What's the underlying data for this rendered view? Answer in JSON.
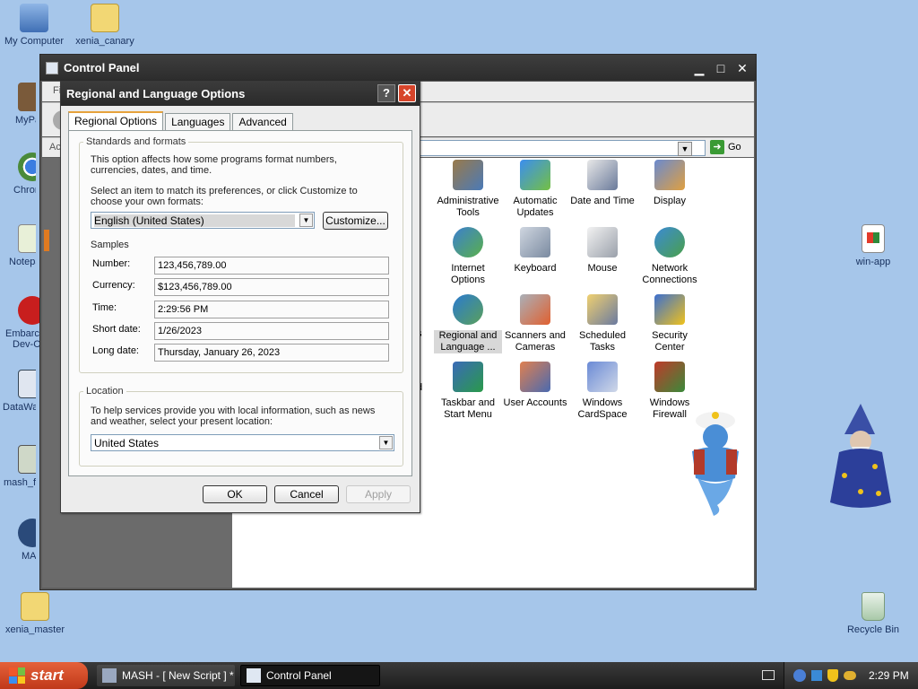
{
  "desktop_icons": {
    "my_computer": "My Computer",
    "xenia_canary": "xenia_canary",
    "mypa": "MyPa",
    "chrome": "Chron",
    "notepad": "Notepa",
    "embarcadero_1": "Embarca",
    "embarcadero_2": "Dev-C",
    "datawa": "DataWa",
    "mash_fu": "mash_fu",
    "mas": "MAS",
    "xenia_master": "xenia_master",
    "win_app": "win-app",
    "recycle_bin": "Recycle Bin"
  },
  "control_panel": {
    "title": "Control Panel",
    "menu_fragment": "Fi",
    "address_fragment": "Ac",
    "go_label": "Go",
    "left_fragment_1": "s",
    "left_fragment_2": "d",
    "items": [
      {
        "label1": "Administrative",
        "label2": "Tools",
        "icon": "admin-tools-icon"
      },
      {
        "label1": "Automatic",
        "label2": "Updates",
        "icon": "automatic-updates-icon"
      },
      {
        "label1": "Date and Time",
        "label2": "",
        "icon": "date-time-icon"
      },
      {
        "label1": "Display",
        "label2": "",
        "icon": "display-icon"
      },
      {
        "label1": "Internet",
        "label2": "Options",
        "icon": "internet-options-icon"
      },
      {
        "label1": "Keyboard",
        "label2": "",
        "icon": "keyboard-icon"
      },
      {
        "label1": "Mouse",
        "label2": "",
        "icon": "mouse-icon"
      },
      {
        "label1": "Network",
        "label2": "Connections",
        "icon": "network-icon"
      },
      {
        "label1": "Regional and",
        "label2": "Language ...",
        "icon": "regional-globe-icon"
      },
      {
        "label1": "Scanners and",
        "label2": "Cameras",
        "icon": "scanner-icon"
      },
      {
        "label1": "Scheduled",
        "label2": "Tasks",
        "icon": "scheduled-tasks-icon"
      },
      {
        "label1": "Security",
        "label2": "Center",
        "icon": "security-shield-icon"
      },
      {
        "label1": "Taskbar and",
        "label2": "Start Menu",
        "icon": "taskbar-icon"
      },
      {
        "label1": "User Accounts",
        "label2": "",
        "icon": "user-accounts-icon"
      },
      {
        "label1": "Windows",
        "label2": "CardSpace",
        "icon": "cardspace-icon"
      },
      {
        "label1": "Windows",
        "label2": "Firewall",
        "icon": "firewall-icon"
      }
    ]
  },
  "dialog": {
    "title": "Regional and Language Options",
    "help": "?",
    "close": "✕",
    "tabs": [
      "Regional Options",
      "Languages",
      "Advanced"
    ],
    "standards": {
      "legend": "Standards and formats",
      "para1": "This option affects how some programs format numbers, currencies, dates, and time.",
      "para2": "Select an item to match its preferences, or click Customize to choose your own formats:",
      "format_value": "English (United States)",
      "customize": "Customize..."
    },
    "samples": {
      "title": "Samples",
      "rows": [
        {
          "label": "Number:",
          "value": "123,456,789.00"
        },
        {
          "label": "Currency:",
          "value": "$123,456,789.00"
        },
        {
          "label": "Time:",
          "value": "2:29:56 PM"
        },
        {
          "label": "Short date:",
          "value": "1/26/2023"
        },
        {
          "label": "Long date:",
          "value": "Thursday, January 26, 2023"
        }
      ]
    },
    "location": {
      "legend": "Location",
      "para": "To help services provide you with local information, such as news and weather, select your present location:",
      "value": "United States"
    },
    "ok": "OK",
    "cancel": "Cancel",
    "apply": "Apply"
  },
  "taskbar": {
    "start": "start",
    "tasks": [
      "MASH - [ New Script ] *",
      "Control Panel"
    ],
    "clock": "2:29 PM"
  }
}
